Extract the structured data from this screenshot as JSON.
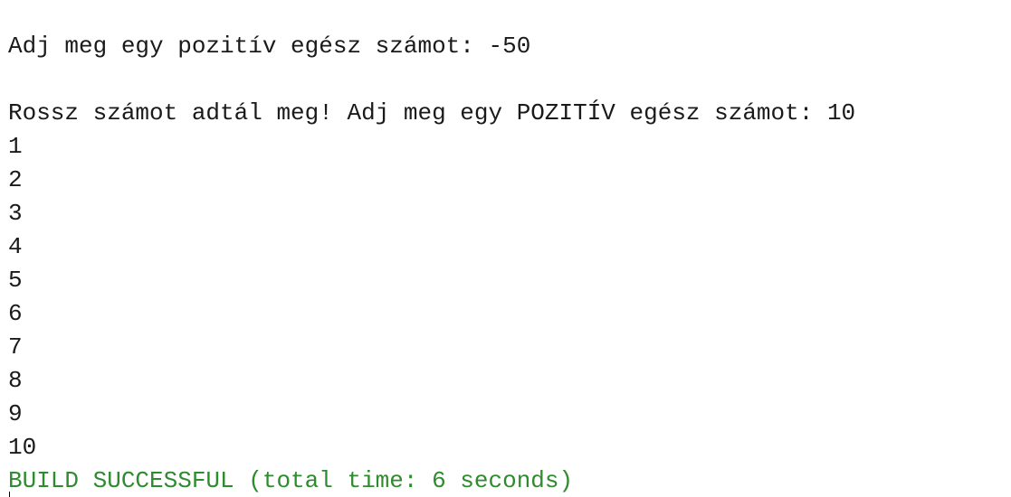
{
  "console": {
    "prompt_line": "Adj meg egy pozitív egész számot: -50",
    "retry_line": "Rossz számot adtál meg! Adj meg egy POZITÍV egész számot: 10",
    "numbers": [
      "1",
      "2",
      "3",
      "4",
      "5",
      "6",
      "7",
      "8",
      "9",
      "10"
    ],
    "build_status": "BUILD SUCCESSFUL (total time: 6 seconds)"
  },
  "colors": {
    "text": "#1a1a1a",
    "success": "#2e8b2e",
    "background": "#ffffff"
  }
}
